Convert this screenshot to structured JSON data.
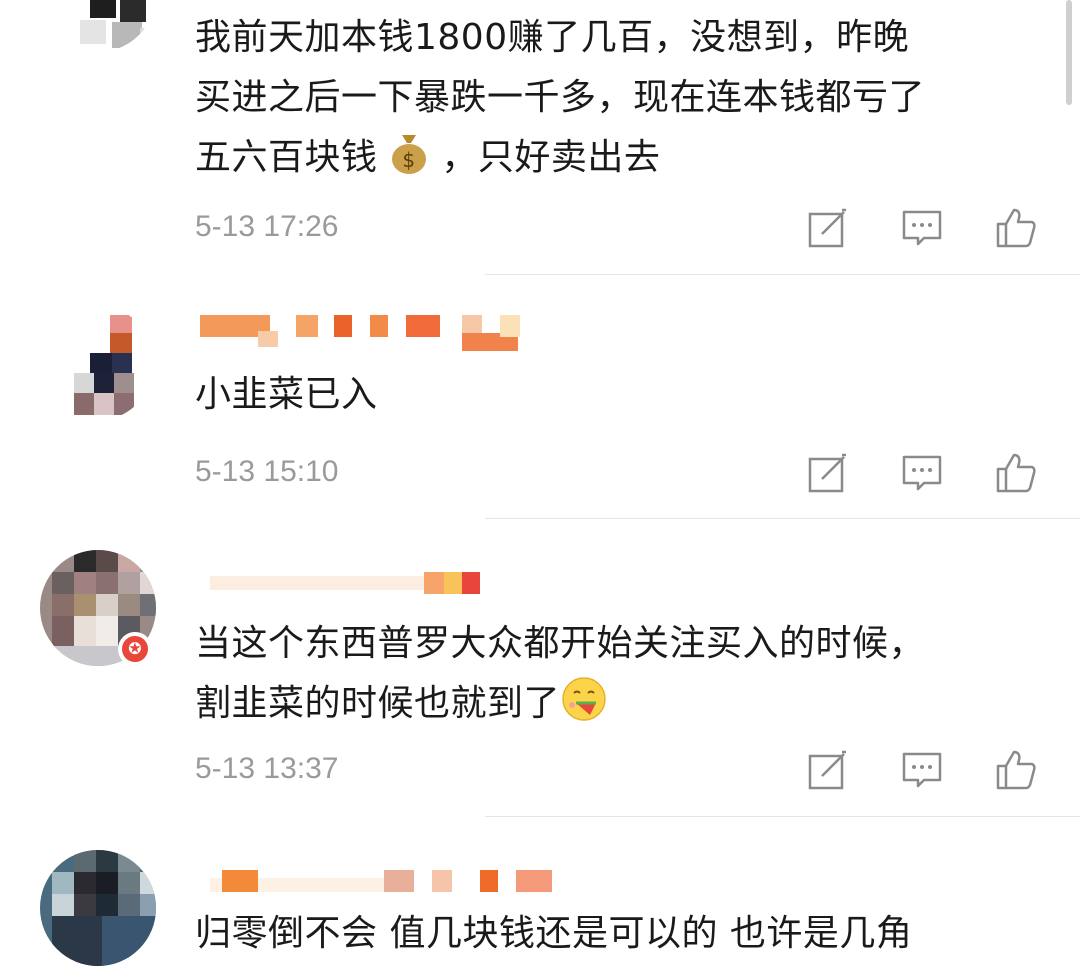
{
  "comments": [
    {
      "text_parts": [
        "我前天加本钱1800赚了几百，没想到，昨晚\n买进之后一下暴跌一千多，现在连本钱都亏了\n五六百块钱",
        "，只好卖出去"
      ],
      "emoji": "money-bag",
      "time": "5-13 17:26"
    },
    {
      "text": "小韭菜已入",
      "time": "5-13 15:10"
    },
    {
      "text_parts": [
        "当这个东西普罗大众都开始关注买入的时候，\n割韭菜的时候也就到了"
      ],
      "emoji": "eating-watermelon-face",
      "time": "5-13 13:37",
      "badge": "✪"
    },
    {
      "text": "归零倒不会 值几块钱还是可以的 也许是几角"
    }
  ],
  "icons": [
    "edit-icon",
    "comment-icon",
    "like-icon"
  ],
  "colors": {
    "text": "#1a1a1a",
    "time": "#9a9a9a",
    "icon": "#8a8a8a",
    "divider": "#e6e6e6",
    "badge": "#e8473a"
  }
}
